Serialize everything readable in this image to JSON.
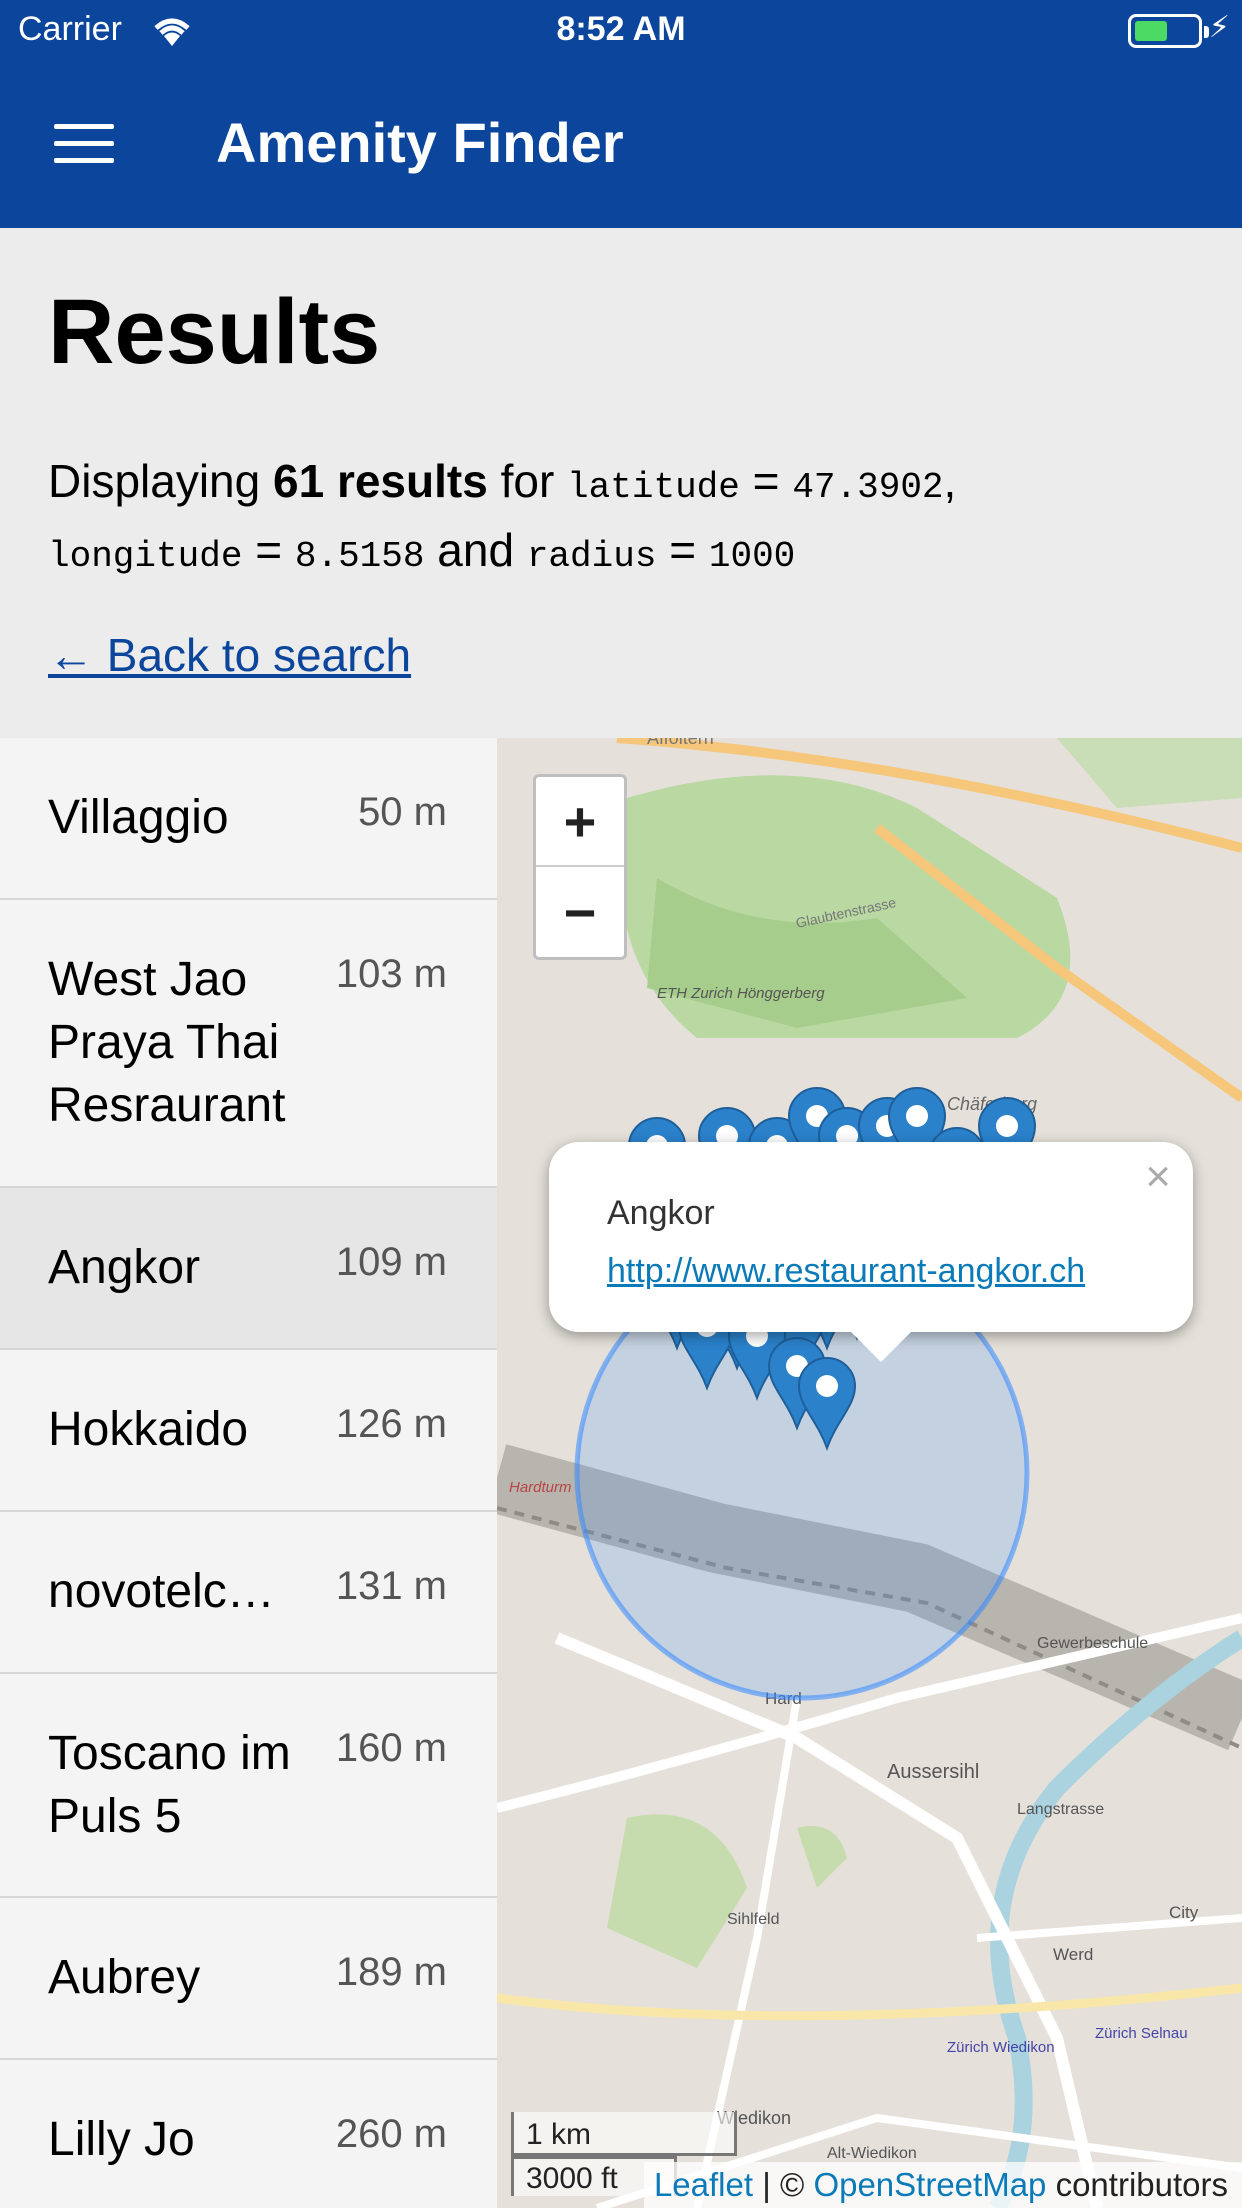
{
  "status_bar": {
    "carrier": "Carrier",
    "time": "8:52 AM"
  },
  "app_bar": {
    "title": "Amenity Finder",
    "menu_icon": "hamburger-menu-icon"
  },
  "header": {
    "title": "Results",
    "summary": {
      "prefix": "Displaying ",
      "count_text": "61 results",
      "for_text": " for ",
      "lat_key": "latitude",
      "lat_value": "47.3902",
      "lon_key": "longitude",
      "lon_value": "8.5158",
      "and_text": "and",
      "radius_key": "radius",
      "radius_value": "1000"
    },
    "back_link": "← Back to search"
  },
  "results": [
    {
      "name": "Villaggio",
      "distance": "50 m"
    },
    {
      "name": "West Jao Praya Thai Resraurant",
      "distance": "103 m"
    },
    {
      "name": "Angkor",
      "distance": "109 m"
    },
    {
      "name": "Hokkaido",
      "distance": "126 m"
    },
    {
      "name": "novotelc…",
      "distance": "131 m"
    },
    {
      "name": "Toscano im Puls 5",
      "distance": "160 m"
    },
    {
      "name": "Aubrey",
      "distance": "189 m"
    },
    {
      "name": "Lilly Jo",
      "distance": "260 m"
    }
  ],
  "map": {
    "zoom_in": "+",
    "zoom_out": "−",
    "popup": {
      "name": "Angkor",
      "url": "http://www.restaurant-angkor.ch",
      "close": "×"
    },
    "scale": {
      "metric": "1 km",
      "imperial": "3000 ft"
    },
    "attribution": {
      "leaflet": "Leaflet",
      "separator": " | © ",
      "osm": "OpenStreetMap",
      "suffix": " contributors"
    },
    "place_labels": [
      "Affoltern",
      "ETH Zurich Hönggerberg",
      "Chäferberg",
      "Glaubtenstrasse",
      "Hardturm",
      "Hard",
      "Aussersihl",
      "Langstrasse",
      "Zürich Wiedikon",
      "Wiedikon",
      "Sihlfeld",
      "Werd",
      "City",
      "Zürich Selnau",
      "Gewerbeschule",
      "Alt-Wiedikon"
    ],
    "colors": {
      "marker": "#2b82cb",
      "radius_circle": "#3388ff",
      "land": "#e5e1da",
      "park": "#b9d8a2"
    }
  }
}
